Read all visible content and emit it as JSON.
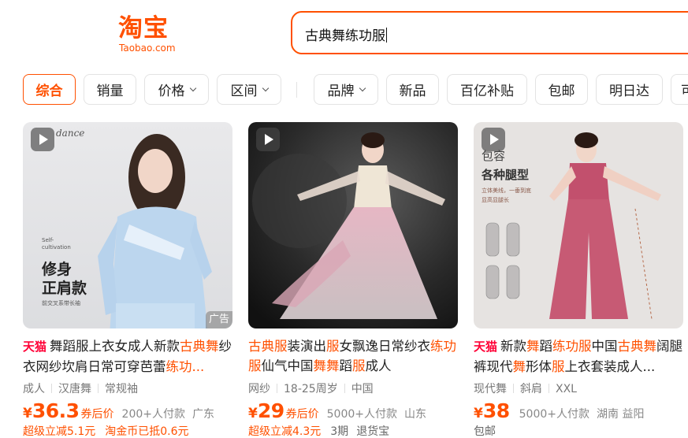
{
  "header": {
    "logo_cn": "淘宝",
    "logo_en": "Taobao.com",
    "search_value": "古典舞练功服",
    "brand_color": "#ff5000"
  },
  "filters": [
    {
      "label": "综合",
      "active": true,
      "dropdown": false
    },
    {
      "label": "销量",
      "active": false,
      "dropdown": false
    },
    {
      "label": "价格",
      "active": false,
      "dropdown": true
    },
    {
      "label": "区间",
      "active": false,
      "dropdown": true
    },
    {
      "label": "品牌",
      "active": false,
      "dropdown": true
    },
    {
      "label": "新品",
      "active": false,
      "dropdown": false
    },
    {
      "label": "百亿补贴",
      "active": false,
      "dropdown": false
    },
    {
      "label": "包邮",
      "active": false,
      "dropdown": false
    },
    {
      "label": "明日达",
      "active": false,
      "dropdown": false
    },
    {
      "label": "可",
      "active": false,
      "dropdown": false
    }
  ],
  "products": [
    {
      "badge": "天猫",
      "title_parts": [
        {
          "t": "舞蹈服上衣女成人新款",
          "hl": false
        },
        {
          "t": "古典舞",
          "hl": true
        },
        {
          "t": "纱衣网纱坎肩日常可穿芭蕾",
          "hl": false
        },
        {
          "t": "练功...",
          "hl": true
        }
      ],
      "tags": [
        "成人",
        "汉唐舞",
        "常规袖"
      ],
      "yen": "¥",
      "price": "36.3",
      "price_note": "券后价",
      "sales": "200+人付款",
      "location": "广东",
      "promos": [
        "超级立减5.1元",
        "淘金币已抵0.6元"
      ],
      "ad_label": "广告",
      "image_text": [
        "dance",
        "Self-",
        "cultivation",
        "修身",
        "正肩款",
        "前交叉系带长袖"
      ]
    },
    {
      "badge": "",
      "title_parts": [
        {
          "t": "古典服",
          "hl": true
        },
        {
          "t": "装演出",
          "hl": false
        },
        {
          "t": "服",
          "hl": true
        },
        {
          "t": "女飘逸日常纱衣",
          "hl": false
        },
        {
          "t": "练功服",
          "hl": true
        },
        {
          "t": "仙气中国",
          "hl": false
        },
        {
          "t": "舞舞",
          "hl": true
        },
        {
          "t": "蹈",
          "hl": false
        },
        {
          "t": "服",
          "hl": true
        },
        {
          "t": "成人",
          "hl": false
        }
      ],
      "tags": [
        "网纱",
        "18-25周岁",
        "中国"
      ],
      "yen": "¥",
      "price": "29",
      "price_note": "券后价",
      "sales": "5000+人付款",
      "location": "山东",
      "promos": [
        "超级立减4.3元",
        "3期",
        "退货宝"
      ],
      "ad_label": "",
      "image_text": []
    },
    {
      "badge": "天猫",
      "title_parts": [
        {
          "t": "新款",
          "hl": false
        },
        {
          "t": "舞",
          "hl": true
        },
        {
          "t": "蹈",
          "hl": false
        },
        {
          "t": "练功服",
          "hl": true
        },
        {
          "t": "中国",
          "hl": false
        },
        {
          "t": "古典舞",
          "hl": true
        },
        {
          "t": "阔腿裤现代",
          "hl": false
        },
        {
          "t": "舞",
          "hl": true
        },
        {
          "t": "形体",
          "hl": false
        },
        {
          "t": "服",
          "hl": true
        },
        {
          "t": "上衣套装成人...",
          "hl": false
        }
      ],
      "tags": [
        "现代舞",
        "斜肩",
        "XXL"
      ],
      "yen": "¥",
      "price": "38",
      "price_note": "",
      "sales": "5000+人付款",
      "location": "湖南 益阳",
      "promos": [
        "包邮"
      ],
      "ad_label": "",
      "image_text": [
        "包容",
        "各种腿型",
        "立体美线，一垂到底",
        "显高显腿长"
      ]
    }
  ]
}
